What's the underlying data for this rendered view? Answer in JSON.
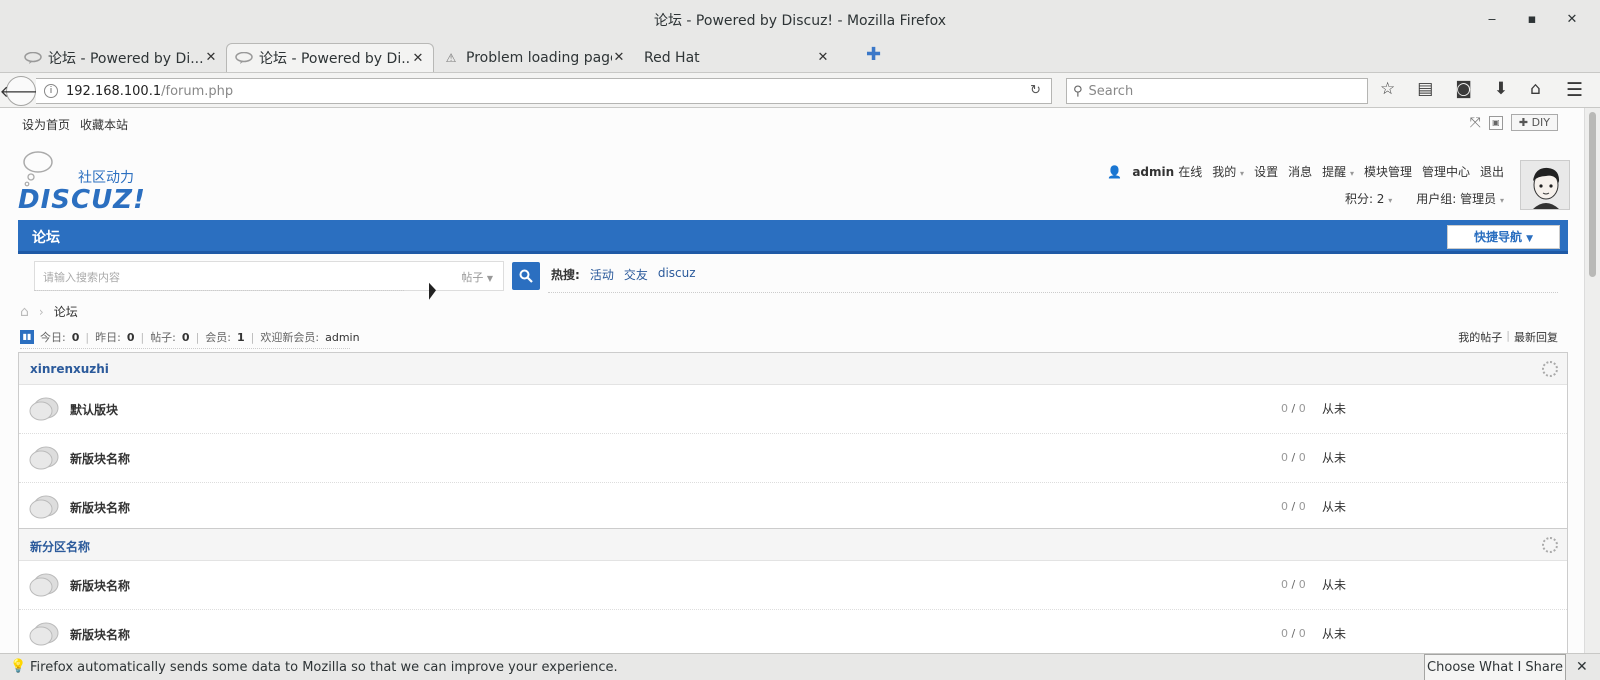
{
  "window": {
    "title": "论坛 - Powered by Discuz! - Mozilla Firefox"
  },
  "tabs": [
    {
      "title": "论坛 - Powered by Di...",
      "icon": "discuz-favicon"
    },
    {
      "title": "论坛 - Powered by Di...",
      "icon": "discuz-favicon"
    },
    {
      "title": "Problem loading page",
      "icon": "warning-icon"
    },
    {
      "title": "Red Hat",
      "icon": ""
    }
  ],
  "address": {
    "host": "192.168.100.1",
    "path": "/forum.php"
  },
  "search": {
    "placeholder": "Search"
  },
  "topbar": {
    "set_home": "设为首页",
    "bookmark": "收藏本站",
    "diy": "DIY"
  },
  "logo": {
    "slogan": "社区动力",
    "brand": "DISCUZ!"
  },
  "user": {
    "name": "admin",
    "status": "在线",
    "mine": "我的",
    "settings": "设置",
    "messages": "消息",
    "reminders": "提醒",
    "module_mgmt": "模块管理",
    "admin_center": "管理中心",
    "logout": "退出",
    "points": "积分: 2",
    "group": "用户组: 管理员"
  },
  "nav": {
    "forum": "论坛",
    "quick_nav": "快捷导航"
  },
  "forum_search": {
    "placeholder": "请输入搜索内容",
    "scope": "帖子",
    "hot_label": "热搜:",
    "hot": [
      "活动",
      "交友",
      "discuz"
    ]
  },
  "breadcrumb": {
    "current": "论坛"
  },
  "stats": {
    "today_label": "今日:",
    "today": "0",
    "yesterday_label": "昨日:",
    "yesterday": "0",
    "posts_label": "帖子:",
    "posts": "0",
    "members_label": "会员:",
    "members": "1",
    "welcome": "欢迎新会员:",
    "newest": "admin"
  },
  "links": {
    "my_posts": "我的帖子",
    "latest": "最新回复"
  },
  "categories": [
    {
      "name": "xinrenxuzhi",
      "forums": [
        {
          "name": "默认版块",
          "threads": "0",
          "posts": "0",
          "last": "从未"
        },
        {
          "name": "新版块名称",
          "threads": "0",
          "posts": "0",
          "last": "从未"
        },
        {
          "name": "新版块名称",
          "threads": "0",
          "posts": "0",
          "last": "从未"
        }
      ]
    },
    {
      "name": "新分区名称",
      "forums": [
        {
          "name": "新版块名称",
          "threads": "0",
          "posts": "0",
          "last": "从未"
        },
        {
          "name": "新版块名称",
          "threads": "0",
          "posts": "0",
          "last": "从未"
        }
      ]
    }
  ],
  "notification": {
    "text": "Firefox automatically sends some data to Mozilla so that we can improve your experience.",
    "button": "Choose What I Share"
  },
  "colors": {
    "accent": "#2b6fc0"
  }
}
